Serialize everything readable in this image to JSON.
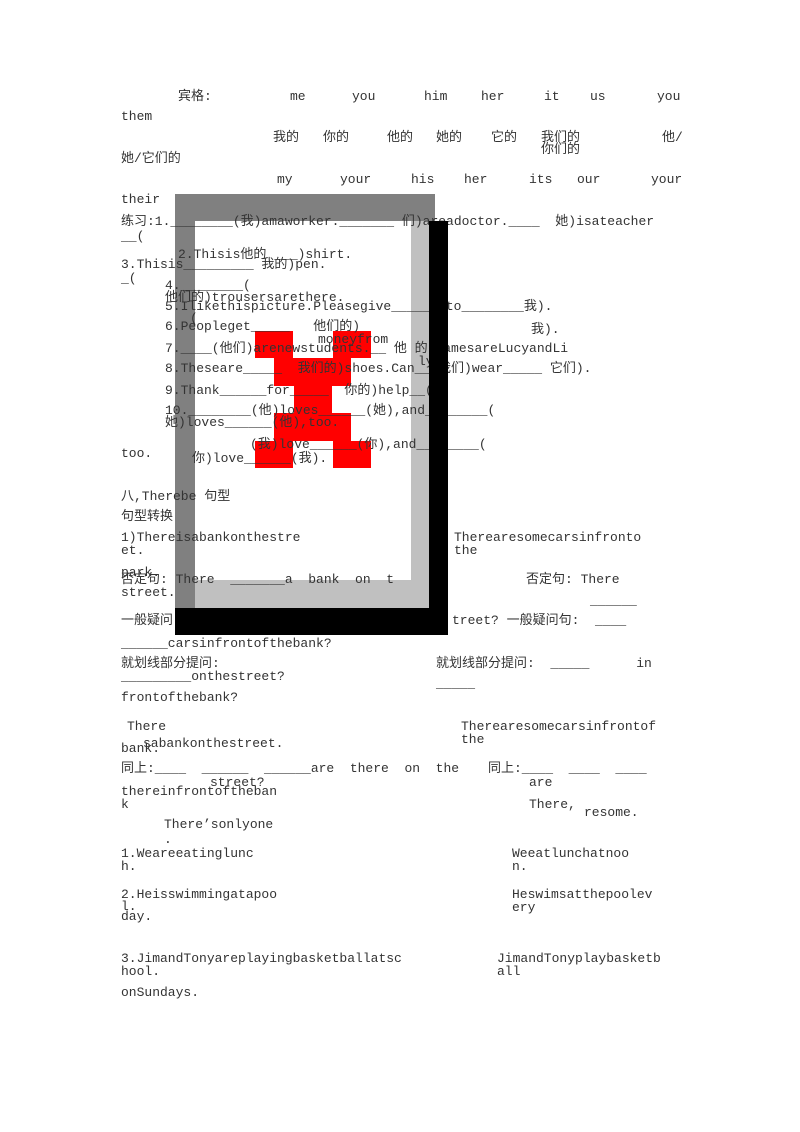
{
  "colors": {
    "text": "#333333",
    "frame_dark": "#808080",
    "frame_light": "#c0c0c0",
    "figure": "#ff0000",
    "shadow": "#000000"
  },
  "items": [
    "宾格:",
    "me",
    "you",
    "him",
    "her",
    "it",
    "us",
    "you",
    "them",
    "我的",
    "你的",
    "他的",
    "她的",
    "它的",
    "我们的",
    "你们的",
    "他/",
    "她/它们的",
    "my",
    "your",
    "his",
    "her",
    "its",
    "our",
    "your",
    "their",
    "练习:1.________(我)amaworker._______ 们)areadoctor.____  她)isateacher",
    "__(",
    "2.Thisis他的 ___)shirt.",
    "3.Thisis_________ 我的)pen.",
    "_(",
    "4.________(",
    "他们的)trousersarethere.",
    "5.Ilikethispicture.Pleasegive______)to________我).",
    "(",
    "6.Peopleget_____   他们的)",
    "我).",
    "moneyfrom",
    "7.____(他们)arenewstudents.__ 他 的)namesareLucyandLi",
    "ly",
    "8.Theseare_____  我们的)shoes.Can__ 我们)wear_____ 它们).",
    "9.Thank______for_____  你的)help__(",
    "10.________(他)loves______(她),and________(",
    "她)loves______(他),too.",
    "(我)love______(你),and________(",
    "too.",
    "你)love______(我).",
    "八,Therebe 句型",
    "句型转换",
    "1)Thereisabankonthestre",
    "et.",
    "Therearesomecarsinfronto",
    "the",
    "park.",
    "否定句: There  _______a  bank  on  t",
    "street.",
    "否定句: There",
    "______",
    "一般疑问",
    "treet? 一般疑问句:  ____",
    "______carsinfrontofthebank?",
    "就划线部分提问:",
    "就划线部分提问:  _____      in",
    "_________onthestreet?",
    "_____",
    "frontofthebank?",
    "There",
    "sabankonthestreet.",
    "bank.",
    "Therearesomecarsinfrontof",
    "the",
    "同上:____  ______  ______are  there  on  the",
    "同上:____  ____  ____",
    "street?",
    "are",
    "thereinfrontoftheban",
    "k",
    "There,",
    "resome.",
    "There’sonlyone",
    ".",
    "1.Weareeatinglunc",
    "h.",
    "Weeatlunchatnoo",
    "n.",
    "2.Heisswimmingatapoo",
    "l.",
    "day.",
    "Heswimsatthepoolev",
    "ery",
    "3.JimandTonyareplayingbasketballatsc",
    "hool.",
    "JimandTonyplaybasketb",
    "all",
    "onSundays."
  ]
}
